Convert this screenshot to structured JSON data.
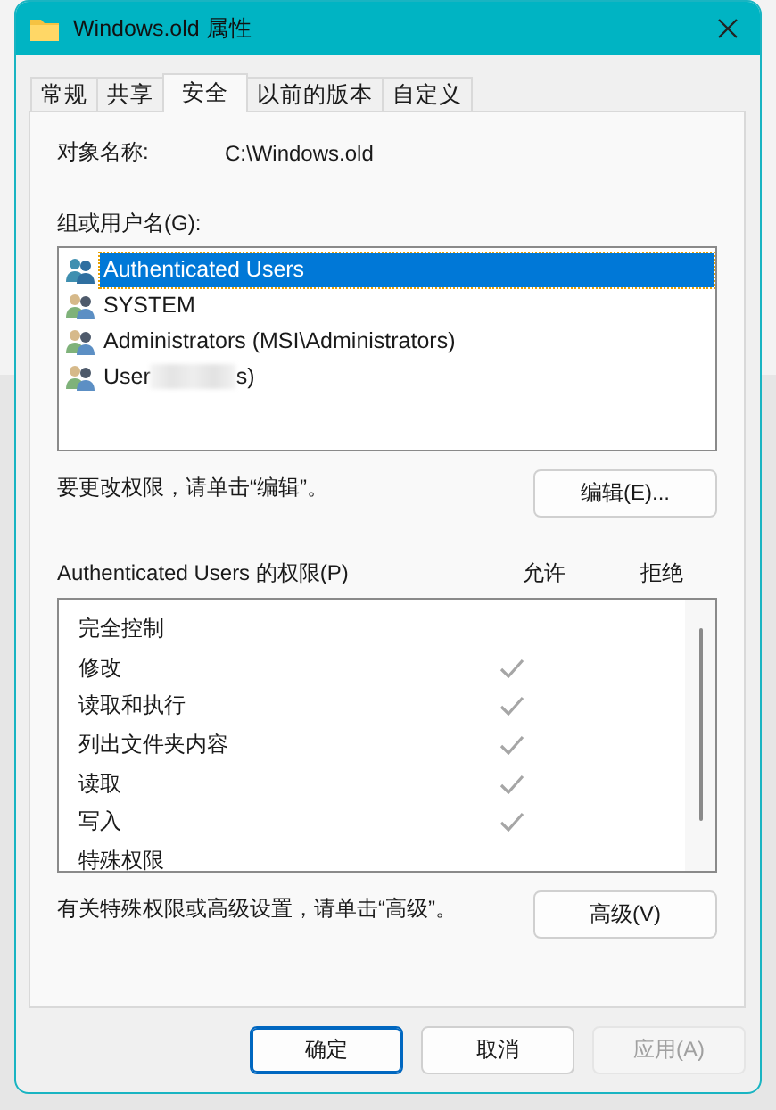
{
  "window": {
    "title": "Windows.old 属性"
  },
  "tabs": [
    {
      "label": "常规",
      "selected": false
    },
    {
      "label": "共享",
      "selected": false
    },
    {
      "label": "安全",
      "selected": true
    },
    {
      "label": "以前的版本",
      "selected": false
    },
    {
      "label": "自定义",
      "selected": false
    }
  ],
  "object_name": {
    "label": "对象名称:",
    "value": "C:\\Windows.old"
  },
  "groups": {
    "label": "组或用户名(G):",
    "items": [
      {
        "label": "Authenticated Users",
        "selected": true,
        "redacted": false
      },
      {
        "label": "SYSTEM",
        "selected": false,
        "redacted": false
      },
      {
        "label": "Administrators (MSI\\Administrators)",
        "selected": false,
        "redacted": false
      },
      {
        "label": "User",
        "suffix": "s)",
        "selected": false,
        "redacted": true
      }
    ]
  },
  "edit_hint": "要更改权限，请单击“编辑”。",
  "edit_button": "编辑(E)...",
  "permissions": {
    "label": "Authenticated Users 的权限(P)",
    "allow_header": "允许",
    "deny_header": "拒绝",
    "items": [
      {
        "label": "完全控制",
        "allow": false,
        "deny": false
      },
      {
        "label": "修改",
        "allow": true,
        "deny": false
      },
      {
        "label": "读取和执行",
        "allow": true,
        "deny": false
      },
      {
        "label": "列出文件夹内容",
        "allow": true,
        "deny": false
      },
      {
        "label": "读取",
        "allow": true,
        "deny": false
      },
      {
        "label": "写入",
        "allow": true,
        "deny": false
      },
      {
        "label": "特殊权限",
        "allow": false,
        "deny": false
      }
    ]
  },
  "advanced_hint": "有关特殊权限或高级设置，请单击“高级”。",
  "advanced_button": "高级(V)",
  "buttons": [
    {
      "label": "确定",
      "kind": "default",
      "disabled": false
    },
    {
      "label": "取消",
      "kind": "normal",
      "disabled": false
    },
    {
      "label": "应用(A)",
      "kind": "normal",
      "disabled": true
    }
  ]
}
